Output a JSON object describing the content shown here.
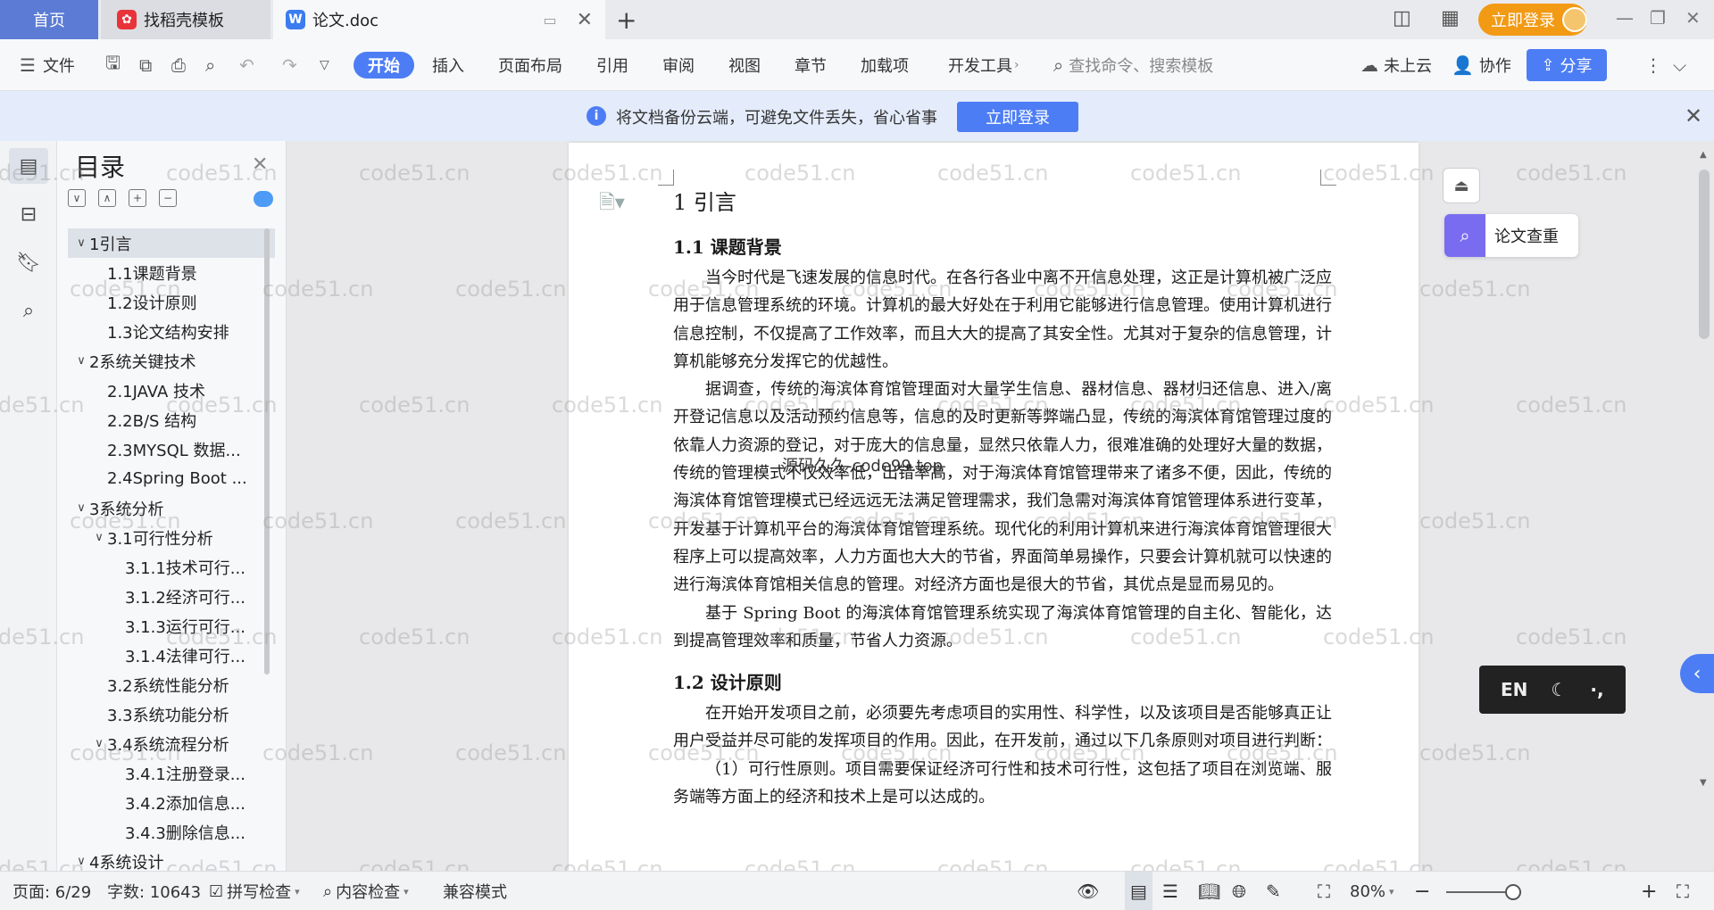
{
  "tabs": {
    "home": "首页",
    "template": "找稻壳模板",
    "document": "论文.doc",
    "new_tab": "+"
  },
  "titlebar": {
    "login": "立即登录"
  },
  "toolbar": {
    "file": "文件",
    "items": [
      "开始",
      "插入",
      "页面布局",
      "引用",
      "审阅",
      "视图",
      "章节",
      "加载项",
      "开发工具"
    ],
    "search_placeholder": "查找命令、搜索模板",
    "cloud": "未上云",
    "collab": "协作",
    "share": "分享"
  },
  "notice": {
    "text": "将文档备份云端，可避免文件丢失，省心省事",
    "button": "立即登录"
  },
  "toc": {
    "title": "目录",
    "items": [
      {
        "label": "1引言",
        "level": 0,
        "caret": "∨"
      },
      {
        "label": "1.1课题背景",
        "level": 1
      },
      {
        "label": "1.2设计原则",
        "level": 1
      },
      {
        "label": "1.3论文结构安排",
        "level": 1
      },
      {
        "label": "2系统关键技术",
        "level": 0,
        "caret": "∨"
      },
      {
        "label": "2.1JAVA 技术",
        "level": 1
      },
      {
        "label": "2.2B/S 结构",
        "level": 1
      },
      {
        "label": "2.3MYSQL 数据...",
        "level": 1
      },
      {
        "label": "2.4Spring Boot ...",
        "level": 1
      },
      {
        "label": "3系统分析",
        "level": 0,
        "caret": "∨"
      },
      {
        "label": "3.1可行性分析",
        "level": 1,
        "caret": "∨"
      },
      {
        "label": "3.1.1技术可行...",
        "level": 2
      },
      {
        "label": "3.1.2经济可行...",
        "level": 2
      },
      {
        "label": "3.1.3运行可行...",
        "level": 2
      },
      {
        "label": "3.1.4法律可行...",
        "level": 2
      },
      {
        "label": "3.2系统性能分析",
        "level": 1
      },
      {
        "label": "3.3系统功能分析",
        "level": 1
      },
      {
        "label": "3.4系统流程分析",
        "level": 1,
        "caret": "∨"
      },
      {
        "label": "3.4.1注册登录...",
        "level": 2
      },
      {
        "label": "3.4.2添加信息...",
        "level": 2
      },
      {
        "label": "3.4.3删除信息...",
        "level": 2
      },
      {
        "label": "4系统设计",
        "level": 0,
        "caret": "∨"
      }
    ]
  },
  "document": {
    "h1": "1 引言",
    "h2_1": "1.1  课题背景",
    "p1": "当今时代是飞速发展的信息时代。在各行各业中离不开信息处理，这正是计算机被广泛应用于信息管理系统的环境。计算机的最大好处在于利用它能够进行信息管理。使用计算机进行信息控制，不仅提高了工作效率，而且大大的提高了其安全性。尤其对于复杂的信息管理，计算机能够充分发挥它的优越性。",
    "p2": "据调查，传统的海滨体育馆管理面对大量学生信息、器材信息、器材归还信息、进入/离开登记信息以及活动预约信息等，信息的及时更新等弊端凸显，传统的海滨体育馆管理过度的依靠人力资源的登记，对于庞大的信息量，显然只依靠人力，很难准确的处理好大量的数据，传统的管理模式不仅效率低，出错率高，对于海滨体育馆管理带来了诸多不便，因此，传统的海滨体育馆管理模式已经远远无法满足管理需求，我们急需对海滨体育馆管理体系进行变革，开发基于计算机平台的海滨体育馆管理系统。现代化的利用计算机来进行海滨体育馆管理很大程序上可以提高效率，人力方面也大大的节省，界面简单易操作，只要会计算机就可以快速的进行海滨体育馆相关信息的管理。对经济方面也是很大的节省，其优点是显而易见的。",
    "p3": "基于 Spring Boot 的海滨体育馆管理系统实现了海滨体育馆管理的自主化、智能化，达到提高管理效率和质量，节省人力资源。",
    "h2_2": "1.2  设计原则",
    "p4": "在开始开发项目之前，必须要先考虑项目的实用性、科学性，以及该项目是否能够真正让用户受益并尽可能的发挥项目的作用。因此，在开发前，通过以下几条原则对项目进行判断：",
    "p5": "（1）可行性原则。项目需要保证经济可行性和技术可行性，这包括了项目在浏览端、服务端等方面上的经济和技术上是可以达成的。"
  },
  "overlay": "源码久久-code99.top",
  "watermark": "code51.cn",
  "right_panel": {
    "check": "论文查重"
  },
  "ime": {
    "lang": "EN"
  },
  "status": {
    "page": "页面: 6/29",
    "words": "字数: 10643",
    "spell": "拼写检查",
    "content": "内容检查",
    "compat": "兼容模式",
    "zoom": "80%"
  },
  "colors": {
    "accent": "#4d7df5",
    "home_tab": "#5b7bd5",
    "login": "#f29a14",
    "check_icon": "#7a6cf0"
  }
}
